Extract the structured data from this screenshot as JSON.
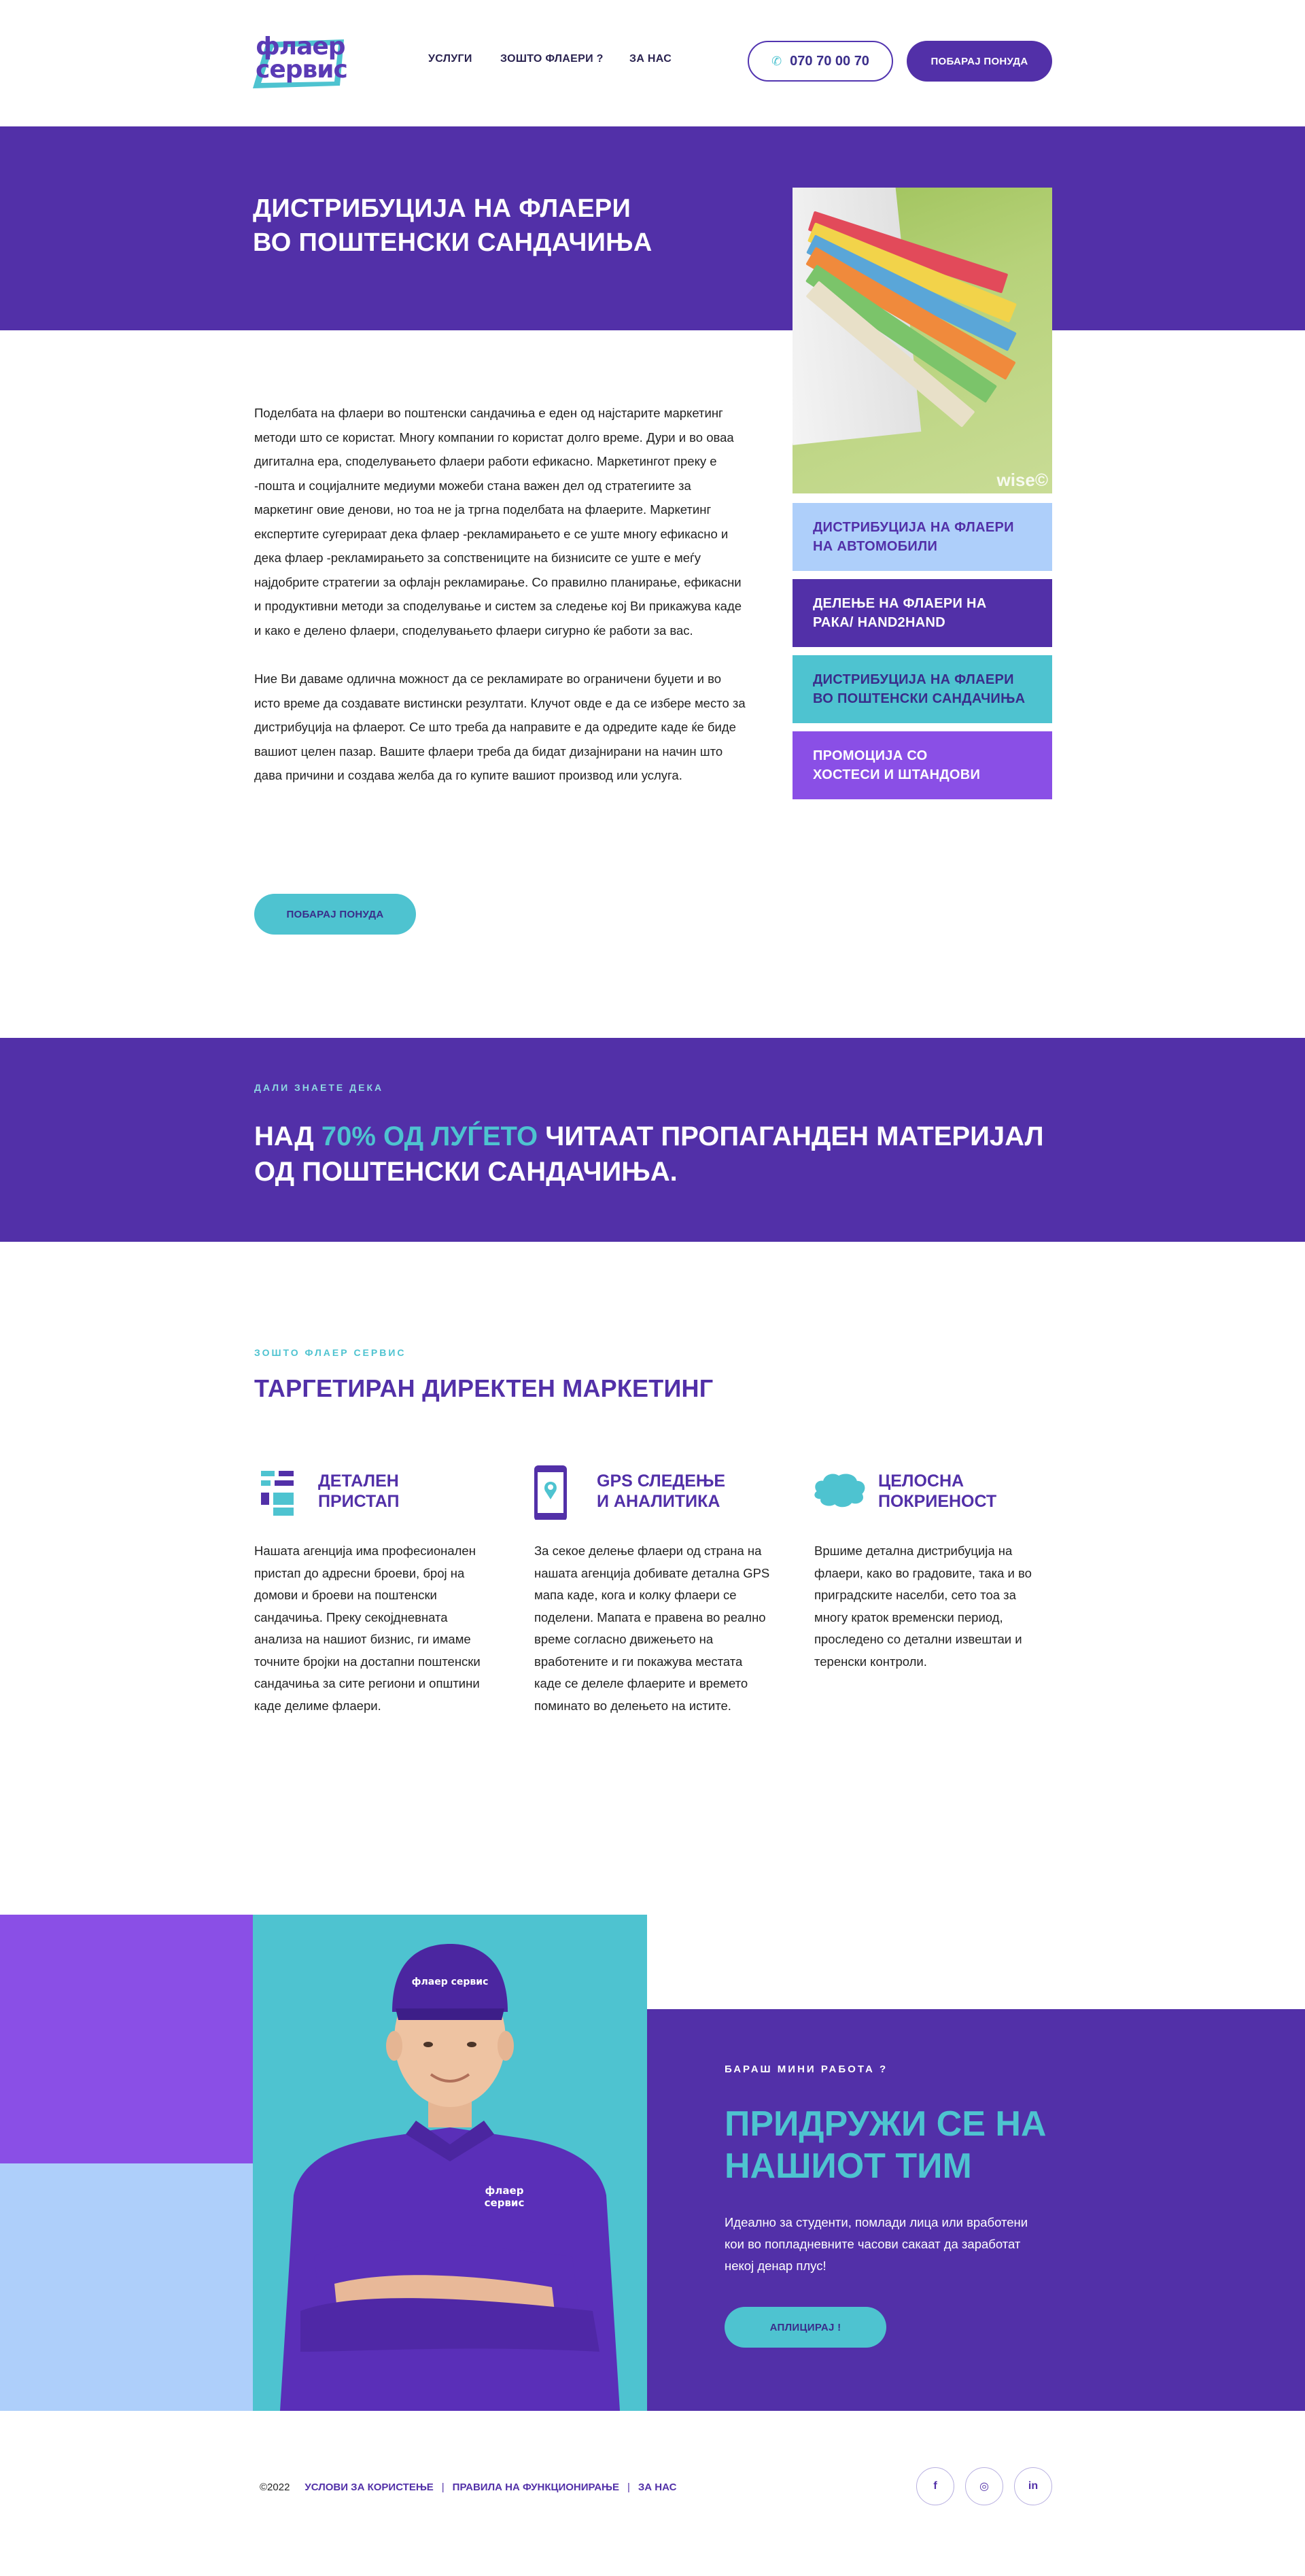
{
  "header": {
    "logo_line1": "флаер",
    "logo_line2": "сервис",
    "nav": [
      "УСЛУГИ",
      "ЗОШТО ФЛАЕРИ ?",
      "ЗА НАС"
    ],
    "phone": "070 70 00 70",
    "offer_button": "ПОБАРАЈ ПОНУДА"
  },
  "hero": {
    "title_line1": "ДИСТРИБУЦИЈА НА ФЛАЕРИ",
    "title_line2": "ВО ПОШТЕНСКИ САНДАЧИЊА",
    "photo_watermark": "wise©"
  },
  "services": [
    {
      "line1": "ДИСТРИБУЦИЈА НА ФЛАЕРИ",
      "line2": "НА АВТОМОБИЛИ",
      "bg": "#aecffa",
      "fg": "#5230a8"
    },
    {
      "line1": "ДЕЛЕЊЕ НА ФЛАЕРИ НА",
      "line2": "РАКА/ HAND2HAND",
      "bg": "#5230a8",
      "fg": "#ffffff"
    },
    {
      "line1": "ДИСТРИБУЦИЈА НА ФЛАЕРИ",
      "line2": "ВО ПОШТЕНСКИ САНДАЧИЊА",
      "bg": "#4ec3d0",
      "fg": "#3a2d8a"
    },
    {
      "line1": "ПРОМОЦИЈА СО",
      "line2": "ХОСТЕСИ И ШТАНДОВИ",
      "bg": "#8a4fe6",
      "fg": "#ffffff"
    }
  ],
  "body": {
    "paragraph1": "Поделбата на флаери во поштенски сандачиња е еден од најстарите маркетинг методи што се користат. Многу компании го користат долго време. Дури и во оваа дигитална ера, споделувањето флаери работи ефикасно. Маркетингот преку е -пошта и социјалните медиуми можеби стана важен дел од стратегиите за маркетинг овие денови, но тоа не ја тргна поделбата на флаерите. Маркетинг експертите сугерираат дека флаер -рекламирањето е се уште многу ефикасно и дека флаер -рекламирањето за сопствениците на бизнисите се уште е меѓу најдобрите стратегии за офлајн рекламирање. Со правилно планирање, ефикасни и продуктивни методи за споделување и систем за следење кој Ви прикажува каде и како е делено флаери, споделувањето флаери сигурно ќе работи за вас.",
    "paragraph2": "Ние Ви даваме одлична можност да се рекламирате во ограничени буџети и во исто време да создавате вистински резултати. Клучот овде е да се избере место за дистрибуција на флаерот. Се што треба да направите е да одредите каде ќе биде вашиот целен пазар. Вашите флаери треба да бидат дизајнирани на начин што дава причини и создава желба да го купите вашиот производ или услуга.",
    "cta": "ПОБАРАЈ ПОНУДА"
  },
  "fact": {
    "kicker": "ДАЛИ ЗНАЕТЕ ДЕКА",
    "prefix": "НАД ",
    "highlight": "70% ОД ЛУЃЕТО",
    "suffix": " ЧИТААТ ПРОПАГАНДЕН МАТЕРИЈАЛ ОД ПОШТЕНСКИ САНДАЧИЊА."
  },
  "why": {
    "kicker": "ЗОШТО ФЛАЕР СЕРВИС",
    "title": "ТАРГЕТИРАН ДИРЕКТЕН МАРКЕТИНГ",
    "features": [
      {
        "head1": "ДЕТАЛЕН",
        "head2": "ПРИСТАП",
        "icon": "list-icon",
        "text": "Нашата агенција има професионален пристап до адресни броеви, број на домови и броеви на поштенски сандачиња. Преку секојдневната анализа на нашиот бизнис, ги имаме точните бројки на достапни поштенски сандачиња за сите региони и општини каде делиме флаери."
      },
      {
        "head1": "GPS СЛЕДЕЊЕ",
        "head2": "И АНАЛИТИКА",
        "icon": "phone-gps-icon",
        "text": "За секое делење флаери од страна на нашата агенција добивате детална GPS мапа каде, кога и колку флаери се поделени. Мапата е правена во реално време согласно движењето на вработените и ги покажува местата каде се делеле флаерите и времето поминато во делењето на истите."
      },
      {
        "head1": "ЦЕЛОСНА",
        "head2": "ПОКРИЕНОСТ",
        "icon": "map-icon",
        "text": "Вршиме детална дистрибуција на флаери, како во градовите, така и во приградските населби, сето тоа за многу краток временски период, проследено со детални извештаи и теренски контроли."
      }
    ]
  },
  "join": {
    "kicker": "БАРАШ МИНИ РАБОТА ?",
    "title_line1": "ПРИДРУЖИ СЕ НА",
    "title_line2": "НАШИОТ ТИМ",
    "text": "Идеално за студенти, помлади лица или вработени кои во попладневните часови сакаат да заработат некој денар плус!",
    "cta": "АПЛИЦИРАЈ !",
    "cap_logo": "флаер сервис"
  },
  "footer": {
    "copyright": "©2022",
    "links": [
      "УСЛОВИ ЗА КОРИСТЕЊЕ",
      "ПРАВИЛА НА ФУНКЦИОНИРАЊЕ",
      "ЗА НАС"
    ],
    "social": [
      "f",
      "◎",
      "in"
    ]
  },
  "colors": {
    "purple": "#5230a8",
    "violet": "#8a4fe6",
    "teal": "#4ec3d0",
    "light_blue": "#aecffa"
  }
}
